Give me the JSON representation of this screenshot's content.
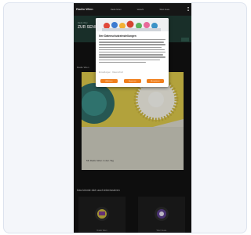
{
  "app": {
    "logo_text": "Radio Wien"
  },
  "header": {
    "nav": [
      {
        "label": "Radio hören"
      },
      {
        "label": "Verkehr"
      },
      {
        "label": "Wien heute"
      }
    ]
  },
  "consent": {
    "title": "Ihre Datenschutzeinstellungen",
    "link_text": "Einstellungen · Datenschutz",
    "buttons": [
      {
        "label": "Ablehnen"
      },
      {
        "label": "Anpassen"
      },
      {
        "label": "Akzeptieren"
      }
    ]
  },
  "page": {
    "section_label": "Radio Wien",
    "band_sub": "Radio Wien",
    "band_title": "ZUR SENDUNG",
    "hero_caption": "Mit Radio Wien in den Tag",
    "more_title": "Das könnte dich auch interessieren",
    "tiles": [
      {
        "label": "Radio Wien"
      },
      {
        "label": "Wien heute"
      }
    ]
  },
  "colors": {
    "accent": "#f07f1d",
    "header_bg": "#1c1c1c",
    "band_bg": "#1f3a33"
  }
}
